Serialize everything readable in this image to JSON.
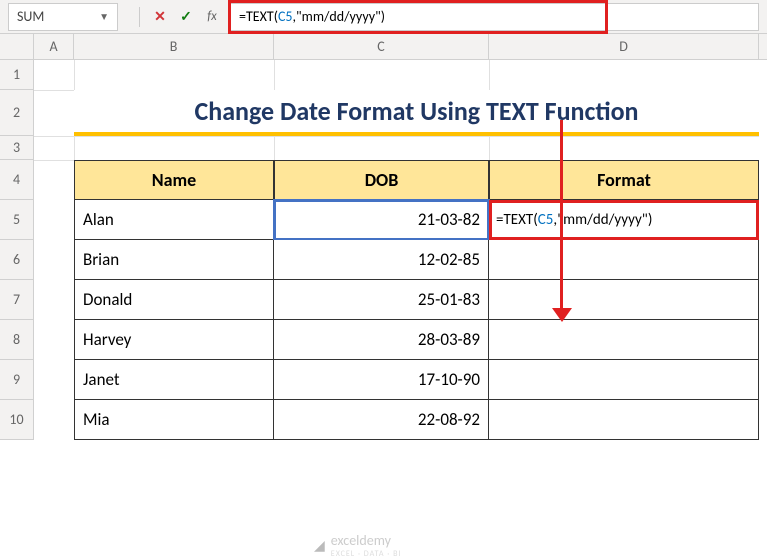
{
  "nameBox": "SUM",
  "formula": {
    "prefix": "=TEXT(",
    "ref": "C5",
    "suffix": ",\"mm/dd/yyyy\")"
  },
  "columns": [
    "A",
    "B",
    "C",
    "D"
  ],
  "rows": [
    "1",
    "2",
    "3",
    "4",
    "5",
    "6",
    "7",
    "8",
    "9",
    "10"
  ],
  "title": "Change Date Format Using TEXT Function",
  "headers": {
    "name": "Name",
    "dob": "DOB",
    "format": "Format"
  },
  "data": [
    {
      "name": "Alan",
      "dob": "21-03-82"
    },
    {
      "name": "Brian",
      "dob": "12-02-85"
    },
    {
      "name": "Donald",
      "dob": "25-01-83"
    },
    {
      "name": "Harvey",
      "dob": "28-03-89"
    },
    {
      "name": "Janet",
      "dob": "17-10-90"
    },
    {
      "name": "Mia",
      "dob": "22-08-92"
    }
  ],
  "d5": {
    "prefix": "=TEXT(",
    "ref": "C5",
    "suffix": ",\"mm/dd/yyyy\")"
  },
  "watermark": {
    "brand": "exceldemy",
    "tagline": "EXCEL · DATA · BI"
  }
}
